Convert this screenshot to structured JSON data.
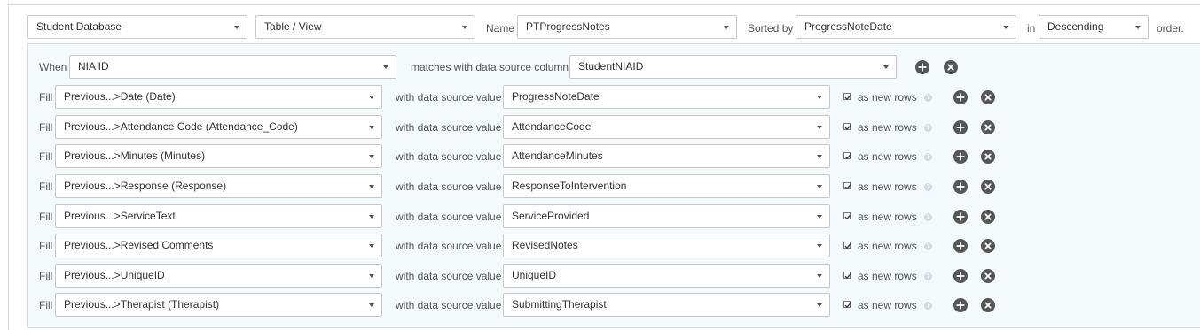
{
  "top": {
    "database": "Student Database",
    "table_view": "Table / View",
    "name_label": "Name",
    "name_value": "PTProgressNotes",
    "sorted_by_label": "Sorted by",
    "sorted_by_value": "ProgressNoteDate",
    "in_label": "in",
    "order_value": "Descending",
    "order_label": "order."
  },
  "when_row": {
    "label": "When",
    "field": "NIA ID",
    "match_label": "matches with data source column",
    "column": "StudentNIAID"
  },
  "fill_label": "Fill",
  "with_label": "with data source value",
  "new_rows_label": "as new rows",
  "help_glyph": "?",
  "fill_rows": [
    {
      "field": "Previous...>Date (Date)",
      "value": "ProgressNoteDate",
      "as_new_rows": true
    },
    {
      "field": "Previous...>Attendance Code (Attendance_Code)",
      "value": "AttendanceCode",
      "as_new_rows": true
    },
    {
      "field": "Previous...>Minutes (Minutes)",
      "value": "AttendanceMinutes",
      "as_new_rows": true
    },
    {
      "field": "Previous...>Response (Response)",
      "value": "ResponseToIntervention",
      "as_new_rows": true
    },
    {
      "field": "Previous...>ServiceText",
      "value": "ServiceProvided",
      "as_new_rows": true
    },
    {
      "field": "Previous...>Revised Comments",
      "value": "RevisedNotes",
      "as_new_rows": true
    },
    {
      "field": "Previous...>UniqueID",
      "value": "UniqueID",
      "as_new_rows": true
    },
    {
      "field": "Previous...>Therapist (Therapist)",
      "value": "SubmittingTherapist",
      "as_new_rows": true
    }
  ],
  "colors": {
    "icon_dark": "#555555",
    "panel_bg": "#f4f9fc",
    "border": "#c8c8c8"
  },
  "icons": {
    "add": "plus-circle-icon",
    "remove": "x-circle-icon",
    "dropdown": "caret-down-icon",
    "help": "question-circle-icon",
    "check": "checkmark-icon"
  }
}
